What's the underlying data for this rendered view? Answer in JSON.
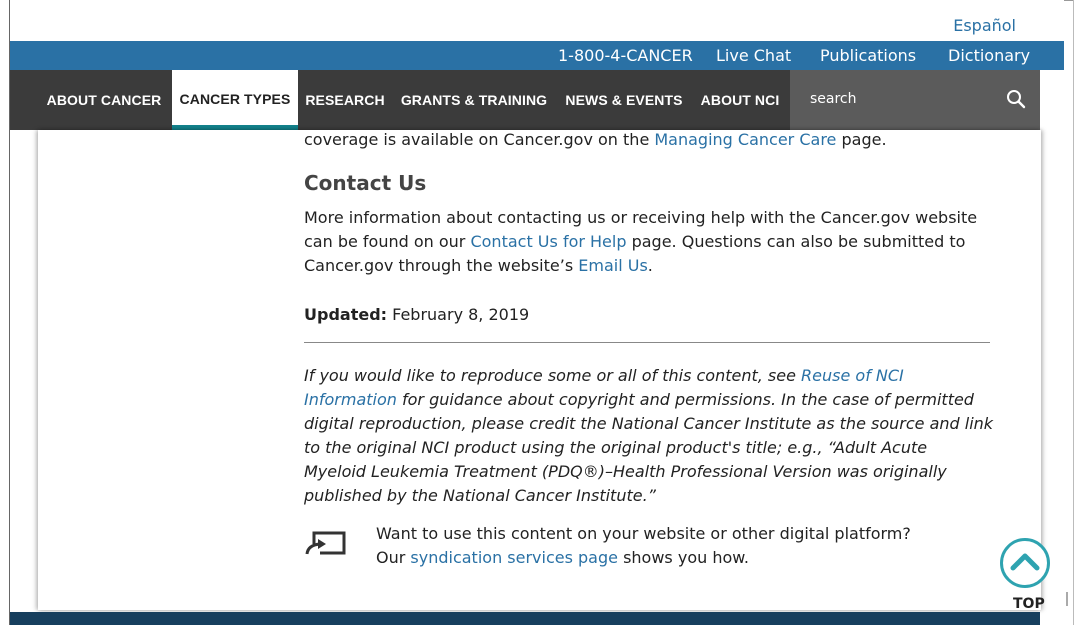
{
  "lang_bar": {
    "espanol": "Español"
  },
  "utility_nav": [
    {
      "label": "1-800-4-CANCER"
    },
    {
      "label": "Live Chat"
    },
    {
      "label": "Publications"
    },
    {
      "label": "Dictionary"
    }
  ],
  "main_nav": [
    {
      "label": "ABOUT CANCER"
    },
    {
      "label": "CANCER TYPES"
    },
    {
      "label": "RESEARCH"
    },
    {
      "label": "GRANTS & TRAINING"
    },
    {
      "label": "NEWS & EVENTS"
    },
    {
      "label": "ABOUT NCI"
    }
  ],
  "search": {
    "placeholder": "search"
  },
  "article": {
    "cut_text_before": "coverage is available on Cancer.gov on the ",
    "cut_link": "Managing Cancer Care",
    "cut_text_after": " page.",
    "contact_heading": "Contact Us",
    "contact_t1": "More information about contacting us or receiving help with the Cancer.gov website can be found on our ",
    "contact_link1": "Contact Us for Help",
    "contact_t2": " page. Questions can also be submitted to Cancer.gov through the website’s ",
    "contact_link2": "Email Us",
    "contact_t3": ".",
    "updated_label": "Updated:",
    "updated_date": " February 8, 2019",
    "reuse_t1": "If you would like to reproduce some or all of this content, see ",
    "reuse_link": "Reuse of NCI Information",
    "reuse_t2": " for guidance about copyright and permissions. In the case of permitted digital reproduction, please credit the National Cancer Institute as the source and link to the original NCI product using the original product's title; e.g., “Adult Acute Myeloid Leukemia Treatment (PDQ®)–Health Professional Version was originally published by the National Cancer Institute.”",
    "synd_t1": "Want to use this content on your website or other digital platform? Our ",
    "synd_link": "syndication services page",
    "synd_t2": " shows you how."
  },
  "top_button": {
    "label": "TOP"
  },
  "colors": {
    "brand_blue": "#2a71a5",
    "nav_dark": "#3b3b3b",
    "teal": "#13828c",
    "footer": "#173f5e"
  }
}
